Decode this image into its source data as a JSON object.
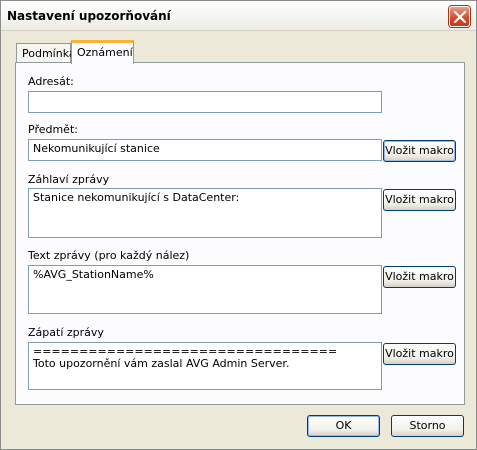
{
  "window": {
    "title": "Nastavení upozorňování"
  },
  "tabs": [
    {
      "label": "Podmínka",
      "active": false
    },
    {
      "label": "Oznámení",
      "active": true
    }
  ],
  "form": {
    "recipient": {
      "label": "Adresát:",
      "value": ""
    },
    "subject": {
      "label": "Předmět:",
      "value": "Nekomunikující stanice"
    },
    "header": {
      "label": "Záhlaví zprávy",
      "value": "Stanice nekomunikující s DataCenter:"
    },
    "body": {
      "label": "Text zprávy (pro každý nález)",
      "value": "%AVG_StationName%"
    },
    "footer": {
      "label": "Zápatí zprávy",
      "value": "=================================\nToto upozornění vám zaslal AVG Admin Server."
    }
  },
  "buttons": {
    "insert_macro": "Vložit makro",
    "ok": "OK",
    "cancel": "Storno"
  },
  "colors": {
    "window_bg": "#ece9d8",
    "close_red": "#d4472b",
    "active_tab_accent": "#fab334",
    "button_border": "#003c74"
  }
}
